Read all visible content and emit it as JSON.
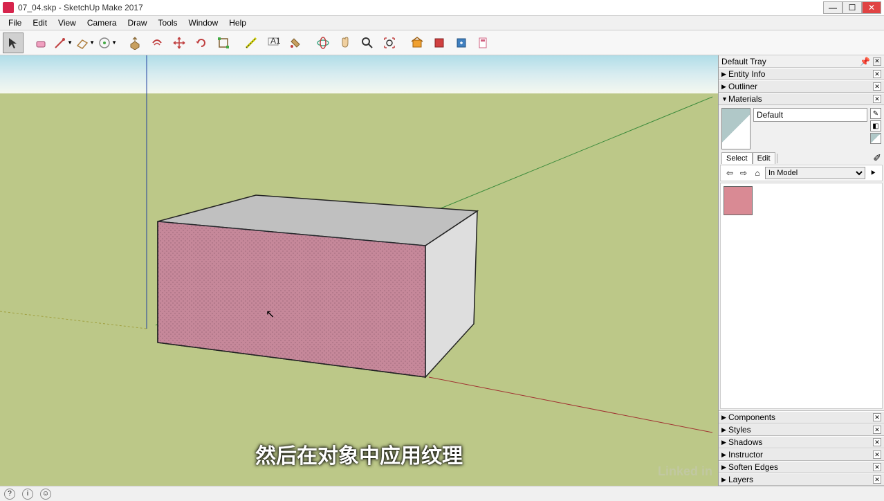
{
  "window": {
    "title": "07_04.skp - SketchUp Make 2017"
  },
  "menu": {
    "items": [
      "File",
      "Edit",
      "View",
      "Camera",
      "Draw",
      "Tools",
      "Window",
      "Help"
    ]
  },
  "toolbar": {
    "tools": [
      {
        "name": "select-tool",
        "glyph": "↖",
        "active": true
      },
      {
        "name": "eraser-tool",
        "glyph": "◇"
      },
      {
        "name": "line-tool",
        "glyph": "✎",
        "dropdown": true
      },
      {
        "name": "shape-tool",
        "glyph": "▱",
        "dropdown": true
      },
      {
        "name": "arc-tool",
        "glyph": "◯",
        "dropdown": true
      },
      {
        "name": "pushpull-tool",
        "glyph": "⬒"
      },
      {
        "name": "offset-tool",
        "glyph": "◉"
      },
      {
        "name": "move-tool",
        "glyph": "✥"
      },
      {
        "name": "rotate-tool",
        "glyph": "↻"
      },
      {
        "name": "scale-tool",
        "glyph": "▦"
      },
      {
        "name": "tape-tool",
        "glyph": "📏"
      },
      {
        "name": "text-tool",
        "glyph": "A"
      },
      {
        "name": "paint-tool",
        "glyph": "🪣"
      },
      {
        "name": "orbit-tool",
        "glyph": "🌐"
      },
      {
        "name": "pan-tool",
        "glyph": "✋"
      },
      {
        "name": "zoom-tool",
        "glyph": "🔍"
      },
      {
        "name": "zoom-extents-tool",
        "glyph": "⛶"
      },
      {
        "name": "warehouse-tool",
        "glyph": "📦"
      },
      {
        "name": "components-tool",
        "glyph": "📕"
      },
      {
        "name": "extension-tool",
        "glyph": "📘"
      },
      {
        "name": "layout-tool",
        "glyph": "📄"
      }
    ]
  },
  "tray": {
    "title": "Default Tray",
    "panels_top": [
      {
        "label": "Entity Info",
        "expanded": false
      },
      {
        "label": "Outliner",
        "expanded": false
      },
      {
        "label": "Materials",
        "expanded": true
      }
    ],
    "panels_bottom": [
      {
        "label": "Components",
        "expanded": false
      },
      {
        "label": "Styles",
        "expanded": false
      },
      {
        "label": "Shadows",
        "expanded": false
      },
      {
        "label": "Instructor",
        "expanded": false
      },
      {
        "label": "Soften Edges",
        "expanded": false
      },
      {
        "label": "Layers",
        "expanded": false
      }
    ]
  },
  "materials": {
    "current_name": "Default",
    "select_tab": "Select",
    "edit_tab": "Edit",
    "library": "In Model"
  },
  "subtitle": "然后在对象中应用纹理",
  "watermark": "Linked in"
}
